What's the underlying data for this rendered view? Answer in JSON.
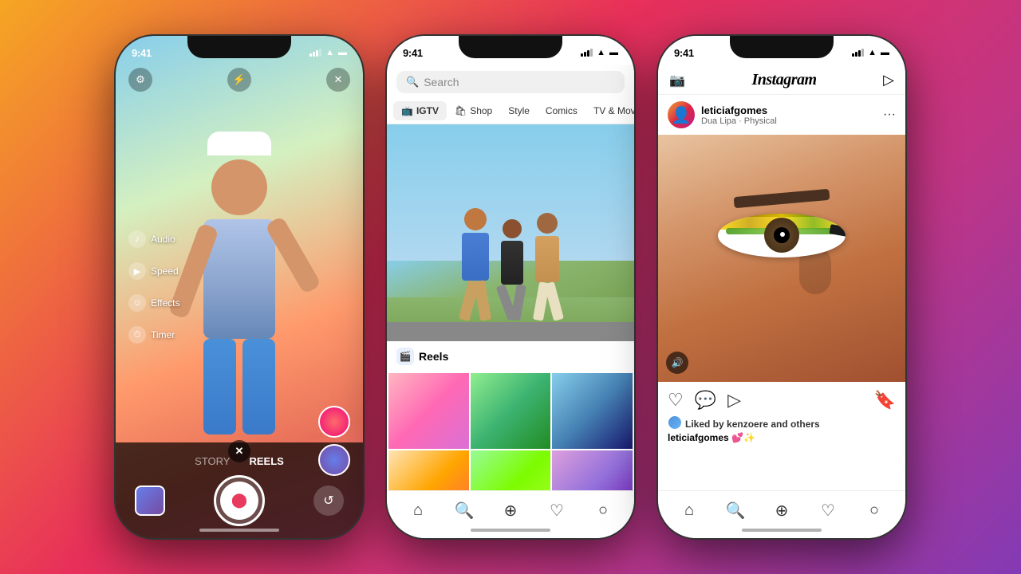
{
  "background": {
    "gradient": "linear-gradient(135deg, #f5a623 0%, #e8305a 40%, #c13584 70%, #833ab4 100%)"
  },
  "phone1": {
    "statusBar": {
      "time": "9:41",
      "signal": "signal-icon",
      "wifi": "wifi-icon",
      "battery": "battery-icon"
    },
    "controls": {
      "audio": "Audio",
      "speed": "Speed",
      "effects": "Effects",
      "timer": "Timer"
    },
    "bottomBar": {
      "story": "STORY",
      "reels": "REELS"
    }
  },
  "phone2": {
    "statusBar": {
      "time": "9:41"
    },
    "search": {
      "placeholder": "Search"
    },
    "categories": [
      {
        "id": "igtv",
        "icon": "📺",
        "label": "IGTV"
      },
      {
        "id": "shop",
        "icon": "🛍",
        "label": "Shop"
      },
      {
        "id": "style",
        "icon": "",
        "label": "Style"
      },
      {
        "id": "comics",
        "icon": "",
        "label": "Comics"
      },
      {
        "id": "tv",
        "icon": "",
        "label": "TV & Movie"
      }
    ],
    "reelsLabel": "Reels",
    "navIcons": [
      "home",
      "search",
      "add",
      "heart",
      "profile"
    ]
  },
  "phone3": {
    "statusBar": {
      "time": "9:41"
    },
    "header": {
      "logo": "Instagram"
    },
    "post": {
      "username": "leticiafgomes",
      "subtitle": "Dua Lipa · Physical",
      "likes": "Liked by kenzoere and others",
      "caption": "leticiafgomes",
      "captionText": "💕✨"
    },
    "navIcons": [
      "home",
      "search",
      "add",
      "heart",
      "profile"
    ]
  }
}
